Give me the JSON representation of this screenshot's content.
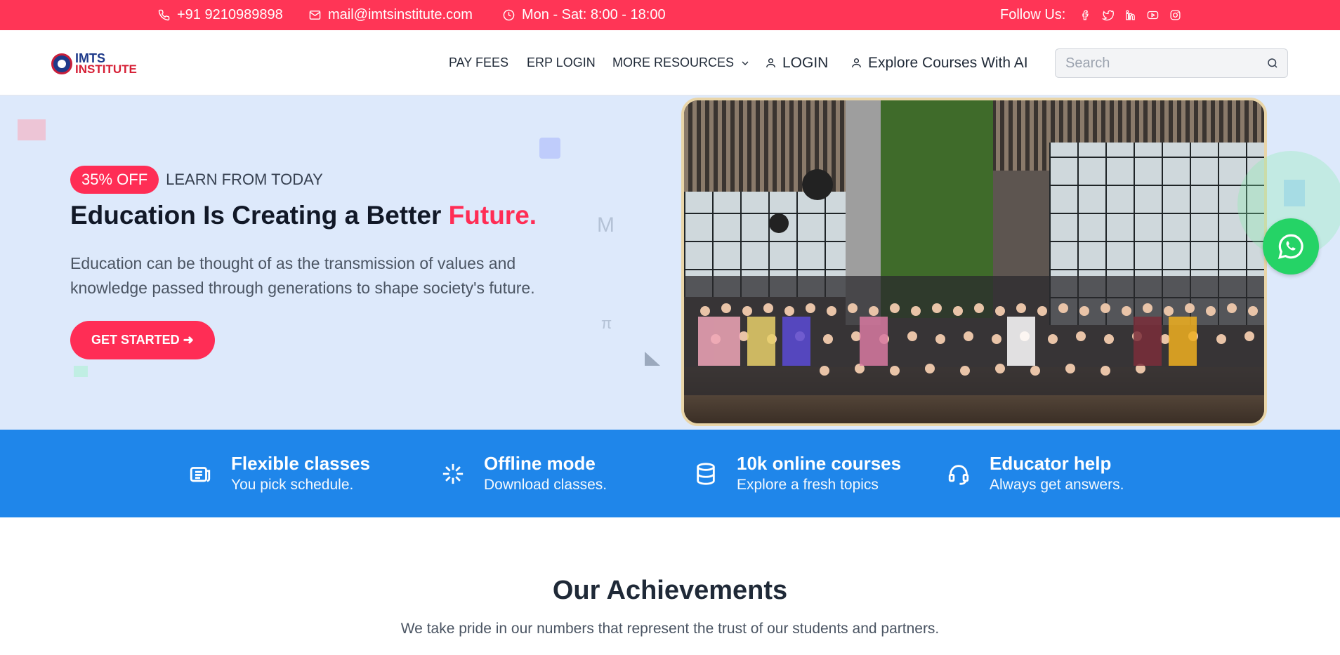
{
  "topbar": {
    "phone": "+91 9210989898",
    "email": "mail@imtsinstitute.com",
    "hours": "Mon - Sat: 8:00 - 18:00",
    "follow_label": "Follow Us:",
    "social_icons": [
      "facebook-icon",
      "twitter-icon",
      "linkedin-icon",
      "youtube-icon",
      "instagram-icon"
    ],
    "bg_color": "#ff3556"
  },
  "header": {
    "logo_line1": "IMTS",
    "logo_line2": "INSTITUTE",
    "nav": {
      "pay_fees": "PAY FEES",
      "erp_login": "ERP LOGIN",
      "more_resources": "MORE RESOURCES",
      "login": "LOGIN",
      "explore_ai": "Explore Courses With AI"
    },
    "search_placeholder": "Search"
  },
  "hero": {
    "badge": "35% OFF",
    "badge_text": "LEARN FROM TODAY",
    "title_main": "Education Is Creating a Better ",
    "title_accent": "Future.",
    "description": "Education can be thought of as the transmission of values and knowledge passed through generations to shape society's future.",
    "cta_label": "GET STARTED ➜",
    "accent_color": "#ff2d55",
    "bg_color": "#dde9fb"
  },
  "features": [
    {
      "icon": "news-icon",
      "title": "Flexible classes",
      "subtitle": "You pick schedule."
    },
    {
      "icon": "sparkle-icon",
      "title": "Offline mode",
      "subtitle": "Download classes."
    },
    {
      "icon": "database-icon",
      "title": "10k online courses",
      "subtitle": "Explore a fresh topics"
    },
    {
      "icon": "headset-icon",
      "title": "Educator help",
      "subtitle": "Always get answers."
    }
  ],
  "features_bg": "#1f86ea",
  "achievements": {
    "title": "Our Achievements",
    "subtitle": "We take pride in our numbers that represent the trust of our students and partners."
  },
  "whatsapp_color": "#25d366"
}
